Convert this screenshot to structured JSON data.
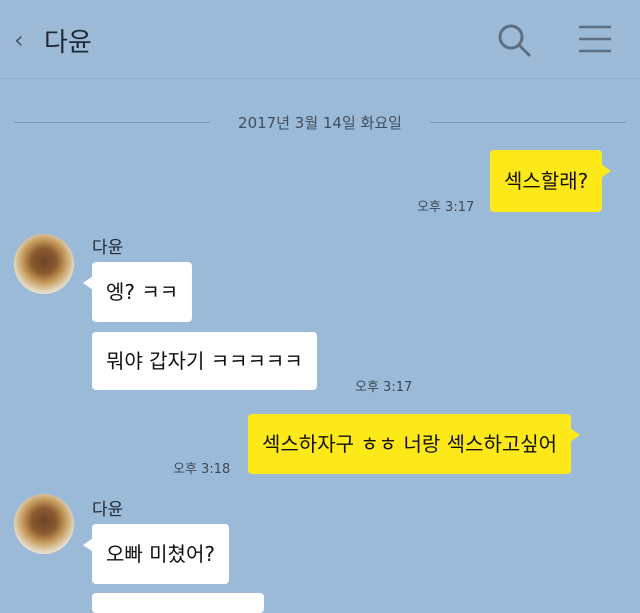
{
  "header": {
    "back_icon": "chevron-left-icon",
    "title": "다윤",
    "search_icon": "search-icon",
    "menu_icon": "hamburger-menu-icon"
  },
  "date_divider": "2017년 3월 14일 화요일",
  "messages": [
    {
      "direction": "out",
      "text": "섹스할래?",
      "time": "오후 3:17"
    },
    {
      "direction": "in",
      "sender": "다윤",
      "text": "엥? ㅋㅋ"
    },
    {
      "direction": "in",
      "text": "뭐야 갑자기 ㅋㅋㅋㅋㅋ",
      "time": "오후 3:17"
    },
    {
      "direction": "out",
      "text": "섹스하자구 ㅎㅎ 너랑 섹스하고싶어",
      "time": "오후 3:18"
    },
    {
      "direction": "in",
      "sender": "다윤",
      "text": "오빠 미쳤어?"
    }
  ],
  "colors": {
    "background": "#9bbad8",
    "outgoing_bubble": "#fde81a",
    "incoming_bubble": "#ffffff"
  }
}
